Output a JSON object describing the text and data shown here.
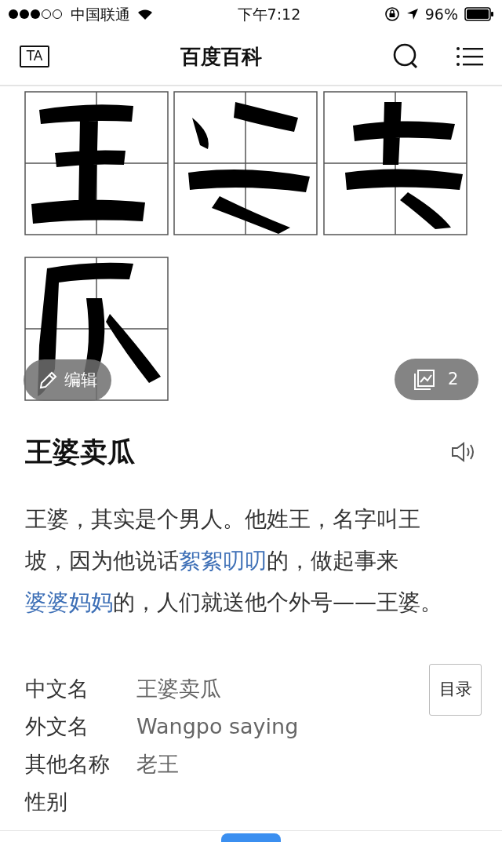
{
  "status_bar": {
    "carrier": "中国联通",
    "time": "下午7:12",
    "battery": "96%"
  },
  "header": {
    "badge": "TA",
    "title": "百度百科"
  },
  "hero": {
    "kind": "picture",
    "edit_label": "编辑",
    "image_count": "2"
  },
  "entry": {
    "title": "王婆卖瓜",
    "summary": [
      {
        "text": "王婆，其实是个男人。他姓王，名字叫王坡，因为他说话",
        "link": false
      },
      {
        "text": "絮絮叨叨",
        "link": true
      },
      {
        "text": "的，做起事来",
        "link": false
      },
      {
        "text": "婆婆妈妈",
        "link": true
      },
      {
        "text": "的，人们就送他个外号——王婆。",
        "link": false
      }
    ]
  },
  "infobox": {
    "rows": [
      {
        "label": "中文名",
        "value": "王婆卖瓜"
      },
      {
        "label": "外文名",
        "value": "Wangpo saying"
      },
      {
        "label": "其他名称",
        "value": "老王"
      },
      {
        "label": "性别"
      }
    ],
    "toc_button": "目录"
  }
}
